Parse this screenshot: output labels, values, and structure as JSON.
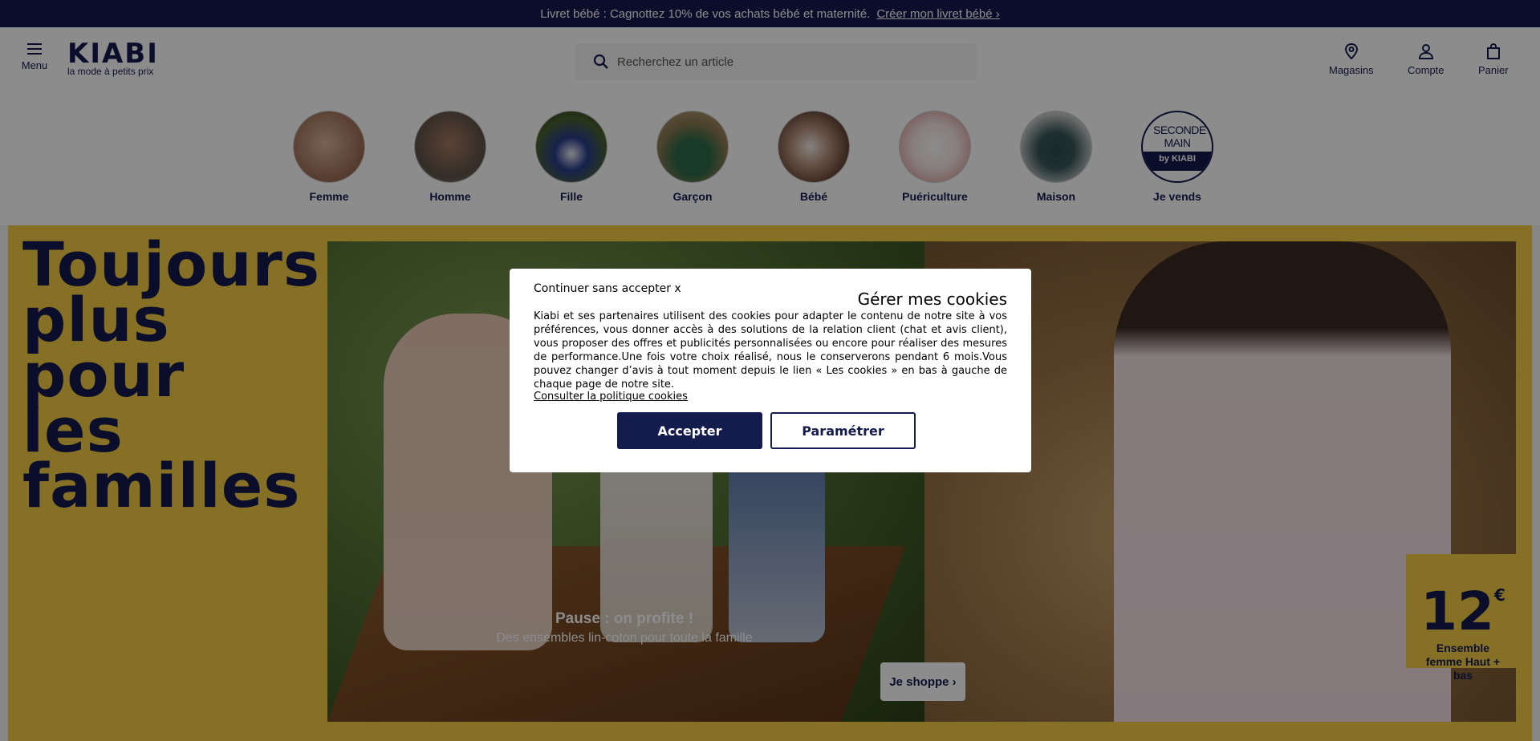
{
  "promo": {
    "text": "Livret bébé : Cagnottez 10% de vos achats bébé et maternité.",
    "link": "Créer mon livret bébé ›"
  },
  "header": {
    "menu_label": "Menu",
    "logo_word": "KIABI",
    "logo_tagline": "la mode à petits prix",
    "search_placeholder": "Recherchez un article",
    "stores_label": "Magasins",
    "account_label": "Compte",
    "cart_label": "Panier"
  },
  "categories": [
    {
      "label": "Femme",
      "color": "#b88a6a"
    },
    {
      "label": "Homme",
      "color": "#6b5a52"
    },
    {
      "label": "Fille",
      "color": "#3a4a2c"
    },
    {
      "label": "Garçon",
      "color": "#7a6a3e"
    },
    {
      "label": "Bébé",
      "color": "#8d6a58"
    },
    {
      "label": "Puériculture",
      "color": "#e9d4cf"
    },
    {
      "label": "Maison",
      "color": "#9aa3a2"
    },
    {
      "label": "Je vends",
      "badge_text": "SECONDE MAIN",
      "badge_brand": "by KIABI"
    }
  ],
  "hero": {
    "title": "Toujours plus pour les familles",
    "headline": "Pause : on profite !",
    "subline": "Des ensembles lin-coton pour toute la famille",
    "cta": "Je shoppe ›",
    "price": "12",
    "currency": "€",
    "price_desc": "Ensemble femme Haut + bas"
  },
  "cookie_modal": {
    "continue_label": "Continuer sans accepter x",
    "title": "Gérer mes cookies",
    "body": "Kiabi et ses partenaires utilisent des cookies pour adapter le contenu de notre site à vos préférences, vous donner accès à des solutions de la relation client (chat et avis client), vous proposer des offres et publicités personnalisées ou encore pour réaliser des mesures de performance.Une fois votre choix réalisé, nous le conserverons pendant 6 mois.Vous pouvez changer d’avis à tout moment depuis le lien « Les cookies » en bas à gauche de chaque page de notre site.",
    "policy_link": "Consulter la politique cookies",
    "accept_label": "Accepter",
    "settings_label": "Paramétrer"
  },
  "colors": {
    "brand_navy": "#141b4d",
    "hero_yellow": "#f3cc46"
  }
}
